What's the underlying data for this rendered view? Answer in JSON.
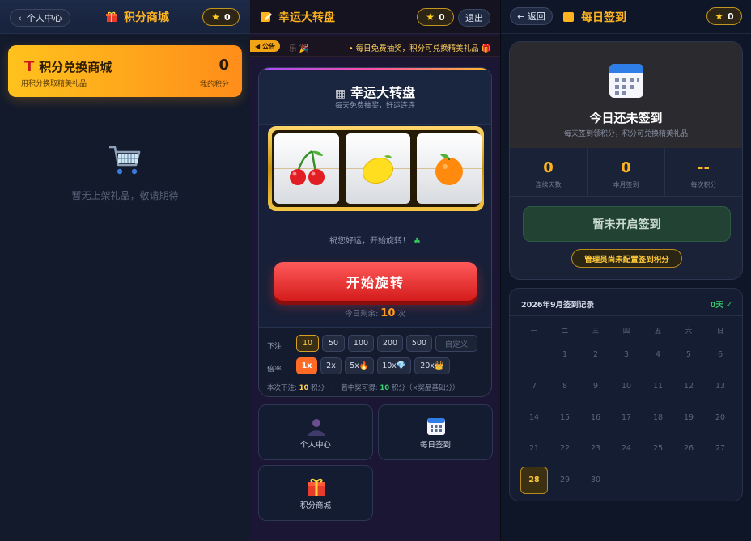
{
  "left": {
    "back_label": "个人中心",
    "title": "积分商城",
    "points_badge": "0",
    "banner": {
      "title": "积分兑换商城",
      "subtitle": "用积分换取精美礼品",
      "points": "0",
      "points_label": "我的积分"
    },
    "empty_text": "暂无上架礼品，敬请期待"
  },
  "middle": {
    "title": "幸运大转盘",
    "points_badge": "0",
    "logout_label": "退出",
    "notice": {
      "tag": "公告",
      "ghost_text": "乐 🎉",
      "text": "• 每日免费抽奖，积分可兑换精美礼品 🎁"
    },
    "card": {
      "title": "幸运大转盘",
      "subtitle": "每天免费抽奖，好运连连",
      "reels": [
        "cherry",
        "lemon",
        "orange"
      ],
      "wish": "祝您好运，开始旋转！",
      "spin_label": "开始旋转",
      "remain_prefix": "今日剩余:",
      "remain_count": "10",
      "remain_suffix": "次",
      "bet_label": "下注",
      "bets": [
        "10",
        "50",
        "100",
        "200",
        "500"
      ],
      "custom_label": "自定义",
      "selected_bet": "10",
      "mult_label": "倍率",
      "multipliers": [
        "1x",
        "2x",
        "5x🔥",
        "10x💎",
        "20x👑"
      ],
      "selected_multiplier": "1x",
      "summary": {
        "prefix": "本次下注:",
        "bet": "10",
        "unit": "积分",
        "sep": "·",
        "win_prefix": "若中奖可得:",
        "win": "10",
        "win_suffix": "积分（×奖品基础分）"
      }
    },
    "nav": [
      {
        "label": "个人中心",
        "icon": "user-icon"
      },
      {
        "label": "每日签到",
        "icon": "calendar-icon"
      },
      {
        "label": "积分商城",
        "icon": "gift-icon"
      }
    ]
  },
  "right": {
    "back_label": "← 返回",
    "title": "每日签到",
    "points_badge": "0",
    "card": {
      "title": "今日还未签到",
      "subtitle": "每天签到领积分，积分可兑换精美礼品",
      "stats": [
        {
          "value": "0",
          "label": "连续天数"
        },
        {
          "value": "0",
          "label": "本月签到"
        },
        {
          "value": "--",
          "label": "每次积分"
        }
      ],
      "button_label": "暂未开启签到",
      "admin_note": "管理员尚未配置签到积分"
    },
    "calendar": {
      "title": "2026年9月签到记录",
      "count": "0天 ✓",
      "weekdays": [
        "一",
        "二",
        "三",
        "四",
        "五",
        "六",
        "日"
      ],
      "first_weekday_index": 1,
      "days_in_month": 30,
      "today": 28
    }
  },
  "colors": {
    "accent": "#ffb41f",
    "spin_red": "#e02828",
    "success": "#38d16d"
  }
}
